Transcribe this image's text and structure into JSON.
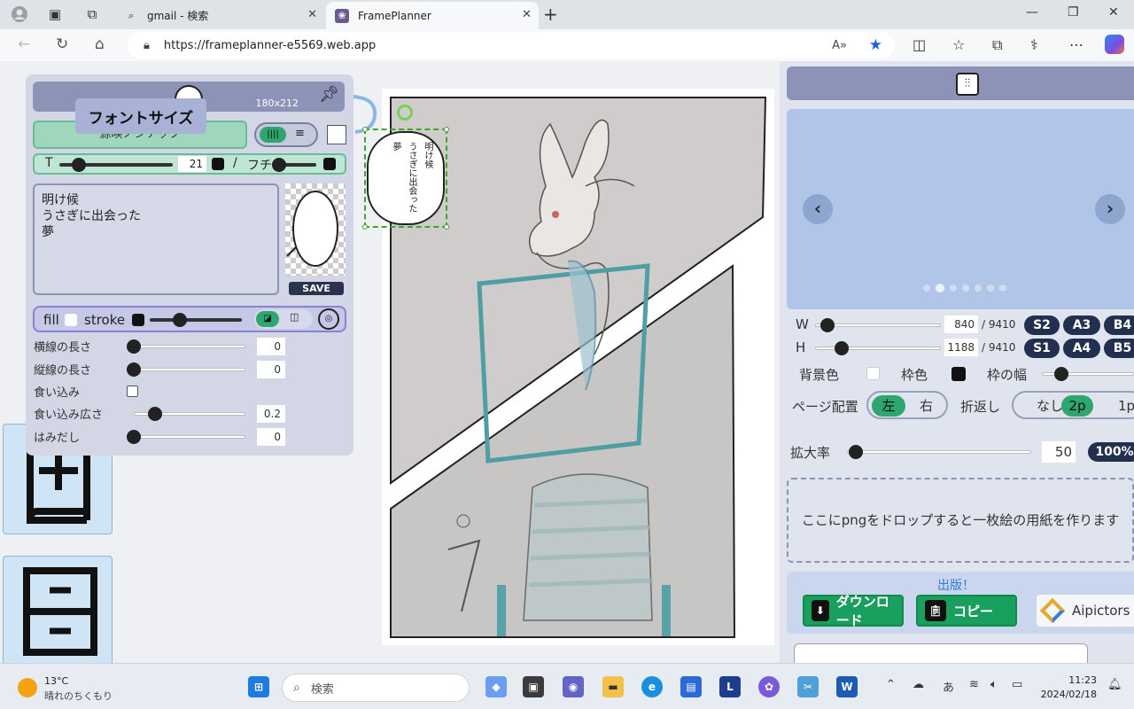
{
  "browser": {
    "tabs": [
      {
        "title": "gmail - 検索",
        "active": false
      },
      {
        "title": "FramePlanner",
        "active": true
      }
    ],
    "url": "https://frameplanner-e5569.web.app"
  },
  "font_panel": {
    "size_label": "180x212",
    "tooltip": "フォントサイズ",
    "font_name": "源暎ノンナップ",
    "size_prefix": "T",
    "font_size_value": "21",
    "separator": "/",
    "outline_label": "フチ",
    "text_content": "明け候\nうさぎに出会った\n夢",
    "save_label": "SAVE",
    "fill_label": "fill",
    "stroke_label": "stroke",
    "props": [
      {
        "label": "横線の長さ",
        "value": "0",
        "type": "slider"
      },
      {
        "label": "縦線の長さ",
        "value": "0",
        "type": "slider"
      },
      {
        "label": "食い込み",
        "value": "",
        "type": "checkbox"
      },
      {
        "label": "食い込み広さ",
        "value": "0.2",
        "type": "slider"
      },
      {
        "label": "はみだし",
        "value": "0",
        "type": "slider"
      }
    ]
  },
  "canvas": {
    "balloon_lines": [
      "明け候",
      "うさぎに出会った",
      "夢"
    ]
  },
  "right_panel": {
    "w_label": "W",
    "h_label": "H",
    "w_value": "840",
    "h_value": "1188",
    "w_max": "/ 9410",
    "h_max": "/ 9410",
    "size_presets_row1": [
      "S2",
      "A3",
      "B4"
    ],
    "size_presets_row2": [
      "S1",
      "A4",
      "B5"
    ],
    "bg_color_label": "背景色",
    "frame_color_label": "枠色",
    "frame_width_label": "枠の幅",
    "page_layout_label": "ページ配置",
    "page_layout_options": [
      "左",
      "右"
    ],
    "page_layout_selected": "左",
    "fold_label": "折返し",
    "fold_options": [
      "なし",
      "2p",
      "1p"
    ],
    "fold_selected": "2p",
    "zoom_label": "拡大率",
    "zoom_value": "50",
    "zoom_button": "100%",
    "dropzone_text": "ここにpngをドロップすると一枚絵の用紙を作ります",
    "publish_title": "出版！",
    "download_label": "ダウンロード",
    "copy_label": "コピー",
    "aipictors_label": "Aipictors",
    "carousel_dots": 7,
    "carousel_active_dot": 1
  },
  "taskbar": {
    "temperature": "13°C",
    "weather_text": "晴れのちくもり",
    "search_placeholder": "検索",
    "time": "11:23",
    "date": "2024/02/18",
    "ime": "あ"
  },
  "colors": {
    "panel_header": "#8c93b6",
    "accent_green": "#2ea66e",
    "carousel_bg": "#b1c5e8",
    "pill_dark": "#22304f"
  }
}
